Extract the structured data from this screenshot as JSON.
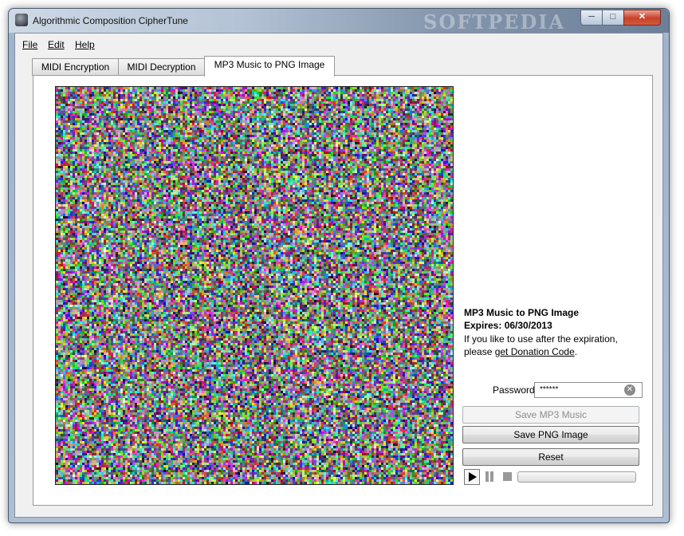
{
  "window": {
    "title": "Algorithmic Composition CipherTune",
    "watermark": "SOFTPEDIA",
    "minimize_glyph": "─",
    "maximize_glyph": "□",
    "close_glyph": "✕"
  },
  "menu": [
    "File",
    "Edit",
    "Help"
  ],
  "tabs": [
    {
      "label": "MIDI Encryption",
      "active": false
    },
    {
      "label": "MIDI Decryption",
      "active": false
    },
    {
      "label": "MP3 Music to PNG Image",
      "active": true
    }
  ],
  "info": {
    "title": "MP3 Music to PNG Image",
    "expires": "Expires: 06/30/2013",
    "line1": "If you like to use after the expiration,",
    "line2_prefix": "please ",
    "line2_link": "get Donation Code",
    "line2_suffix": "."
  },
  "password": {
    "label": "Password:",
    "value": "******"
  },
  "buttons": {
    "save_mp3": "Save MP3 Music",
    "save_png": "Save PNG Image",
    "reset": "Reset"
  },
  "player": {
    "progress": 0
  },
  "colors": {
    "accent": "#37b63a"
  },
  "icons": [
    "app-icon",
    "clear-icon",
    "play-icon",
    "pause-icon",
    "stop-icon"
  ]
}
